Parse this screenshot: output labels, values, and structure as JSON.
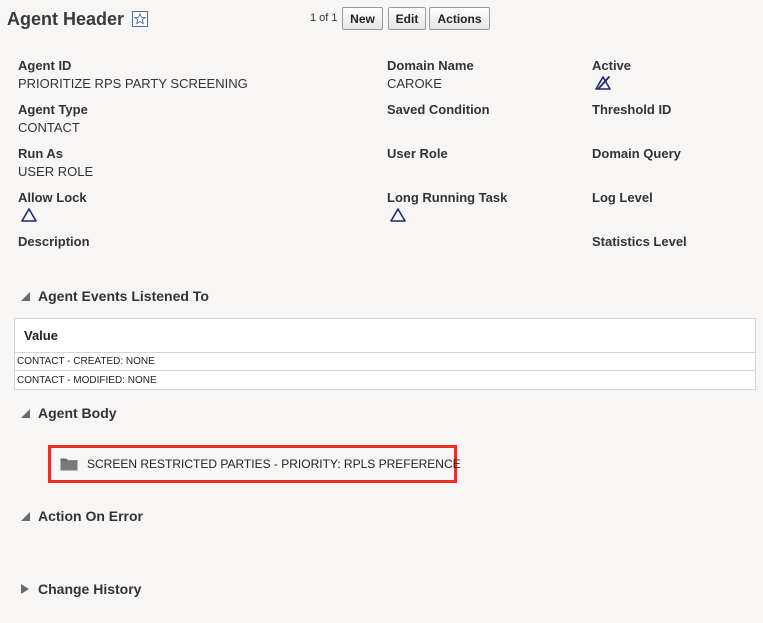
{
  "header": {
    "title": "Agent Header",
    "pager": "1 of 1",
    "buttons": {
      "new": "New",
      "edit": "Edit",
      "actions": "Actions"
    }
  },
  "fields": {
    "agent_id": {
      "label": "Agent ID",
      "value": "PRIORITIZE RPS PARTY SCREENING"
    },
    "domain_name": {
      "label": "Domain Name",
      "value": "CAROKE"
    },
    "active": {
      "label": "Active",
      "icon": "checked-triangle-icon"
    },
    "agent_type": {
      "label": "Agent Type",
      "value": "CONTACT"
    },
    "saved_condition": {
      "label": "Saved Condition"
    },
    "threshold_id": {
      "label": "Threshold ID"
    },
    "run_as": {
      "label": "Run As",
      "value": "USER ROLE"
    },
    "user_role": {
      "label": "User Role"
    },
    "domain_query": {
      "label": "Domain Query"
    },
    "allow_lock": {
      "label": "Allow Lock",
      "icon": "unchecked-triangle-icon"
    },
    "long_running_task": {
      "label": "Long Running Task",
      "icon": "unchecked-triangle-icon"
    },
    "log_level": {
      "label": "Log Level"
    },
    "description": {
      "label": "Description"
    },
    "statistics_level": {
      "label": "Statistics Level"
    }
  },
  "sections": {
    "events": {
      "title": "Agent Events Listened To",
      "column": "Value",
      "rows": [
        "CONTACT - CREATED: NONE",
        "CONTACT - MODIFIED: NONE"
      ]
    },
    "body": {
      "title": "Agent Body",
      "item": "SCREEN RESTRICTED PARTIES - PRIORITY: RPLS PREFERENCE"
    },
    "on_error": {
      "title": "Action On Error"
    },
    "history": {
      "title": "Change History"
    }
  },
  "colors": {
    "highlight": "#ee2e24",
    "icon_navy": "#1f2a6b",
    "folder": "#6e6e6e"
  }
}
